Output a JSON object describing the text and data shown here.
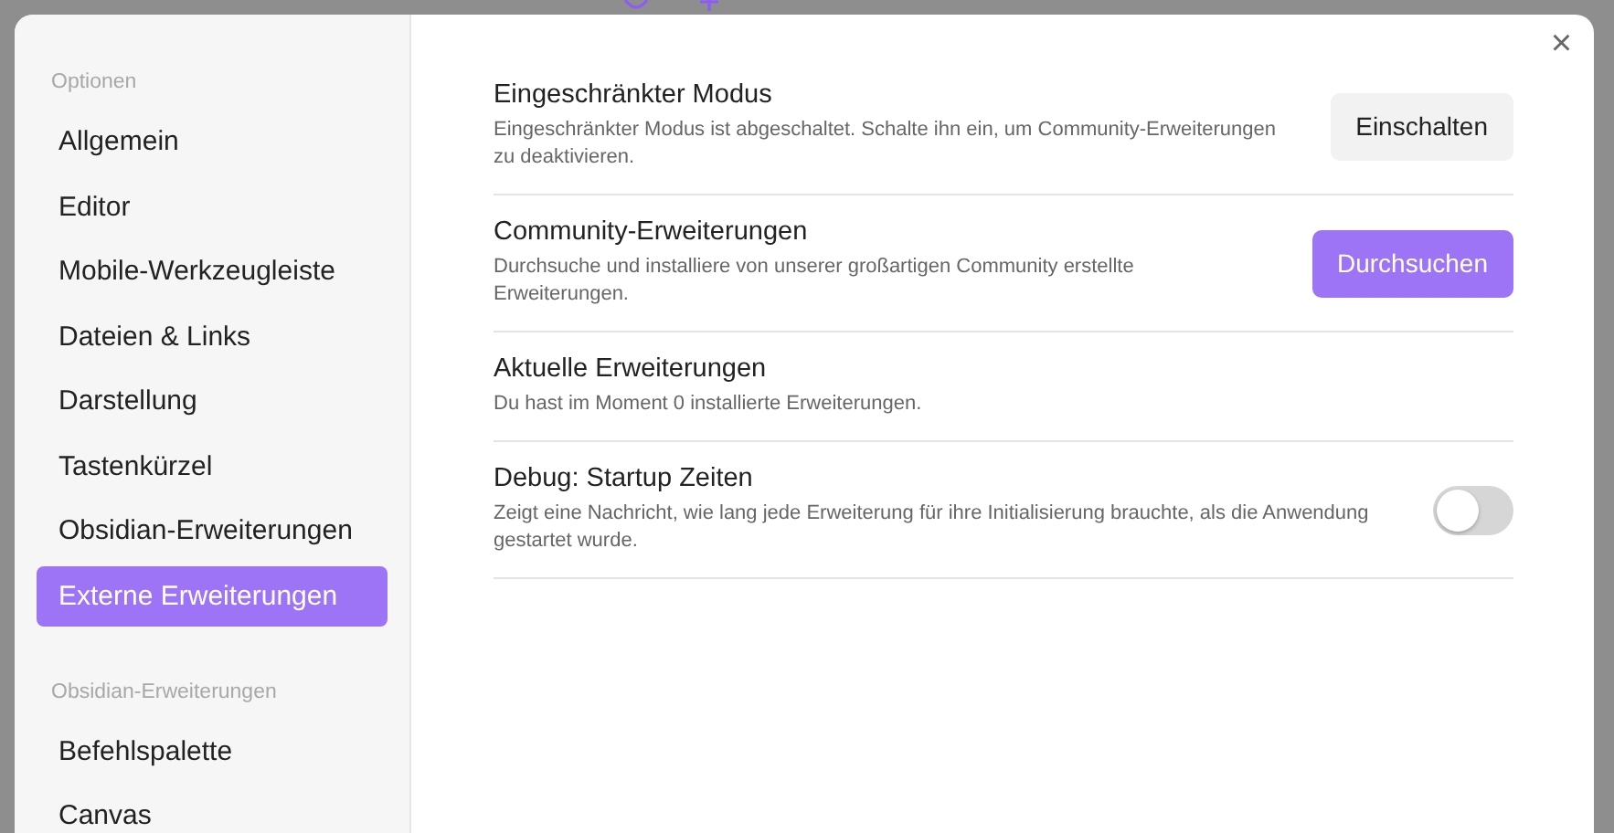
{
  "sidebar": {
    "sections": [
      {
        "heading": "Optionen",
        "items": [
          {
            "label": "Allgemein",
            "selected": false
          },
          {
            "label": "Editor",
            "selected": false
          },
          {
            "label": "Mobile-Werkzeugleiste",
            "selected": false
          },
          {
            "label": "Dateien & Links",
            "selected": false
          },
          {
            "label": "Darstellung",
            "selected": false
          },
          {
            "label": "Tastenkürzel",
            "selected": false
          },
          {
            "label": "Obsidian-Erweiterungen",
            "selected": false
          },
          {
            "label": "Externe Erweiterungen",
            "selected": true
          }
        ]
      },
      {
        "heading": "Obsidian-Erweiterungen",
        "items": [
          {
            "label": "Befehlspalette",
            "selected": false
          },
          {
            "label": "Canvas",
            "selected": false
          }
        ]
      }
    ]
  },
  "close": "×",
  "settings": [
    {
      "kind": "button",
      "name": "Eingeschränkter Modus",
      "description": "Eingeschränkter Modus ist abgeschaltet. Schalte ihn ein, um Community-Erweiterungen zu deaktivieren.",
      "button": {
        "label": "Einschalten",
        "primary": false
      }
    },
    {
      "kind": "button",
      "name": "Community-Erweiterungen",
      "description": "Durchsuche und installiere von unserer großartigen Community erstellte Erweiterungen.",
      "button": {
        "label": "Durchsuchen",
        "primary": true
      }
    },
    {
      "kind": "info",
      "name": "Aktuelle Erweiterungen",
      "description": "Du hast im Moment 0 installierte Erweiterungen."
    },
    {
      "kind": "toggle",
      "name": "Debug: Startup Zeiten",
      "description": "Zeigt eine Nachricht, wie lang jede Erweiterung für ihre Initialisierung brauchte, als die Anwendung gestartet wurde.",
      "on": false
    }
  ]
}
